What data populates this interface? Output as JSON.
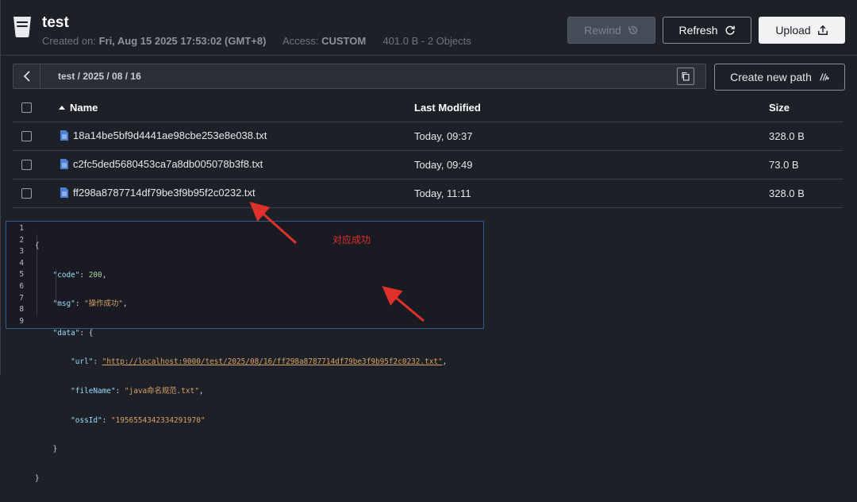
{
  "bucket": {
    "name": "test",
    "created_label": "Created on:",
    "created_value": "Fri, Aug 15 2025 17:53:02 (GMT+8)",
    "access_label": "Access:",
    "access_value": "CUSTOM",
    "usage": "401.0 B - 2 Objects"
  },
  "toolbar": {
    "rewind_label": "Rewind",
    "refresh_label": "Refresh",
    "upload_label": "Upload"
  },
  "path": {
    "text": "test / 2025 / 08 / 16",
    "new_path_label": "Create new path"
  },
  "table": {
    "columns": {
      "name": "Name",
      "modified": "Last Modified",
      "size": "Size"
    },
    "rows": [
      {
        "name": "18a14be5bf9d4441ae98cbe253e8e038.txt",
        "modified": "Today, 09:37",
        "size": "328.0 B"
      },
      {
        "name": "c2fc5ded5680453ca7a8db005078b3f8.txt",
        "modified": "Today, 09:49",
        "size": "73.0 B"
      },
      {
        "name": "ff298a8787714df79be3f9b95f2c0232.txt",
        "modified": "Today, 11:11",
        "size": "328.0 B"
      }
    ]
  },
  "code": {
    "line_numbers": [
      "1",
      "2",
      "3",
      "4",
      "5",
      "6",
      "7",
      "8",
      "9"
    ],
    "open_brace": "{",
    "close_brace": "}",
    "code_key": "\"code\"",
    "code_value": "200",
    "msg_key": "\"msg\"",
    "msg_value": "\"操作成功\"",
    "data_key": "\"data\"",
    "url_key": "\"url\"",
    "url_value": "\"http://localhost:9000/test/2025/08/16/ff298a8787714df79be3f9b95f2c0232.txt\"",
    "filename_key": "\"fileName\"",
    "filename_value": "\"java命名规范.txt\"",
    "ossid_key": "\"ossId\"",
    "ossid_value": "\"1956554342334291970\""
  },
  "annotation": {
    "text": "对应成功",
    "color": "#e0302a"
  },
  "colors": {
    "background": "#1d2026",
    "accent_border": "#2d5f8f",
    "file_icon": "#4a7fd4"
  }
}
